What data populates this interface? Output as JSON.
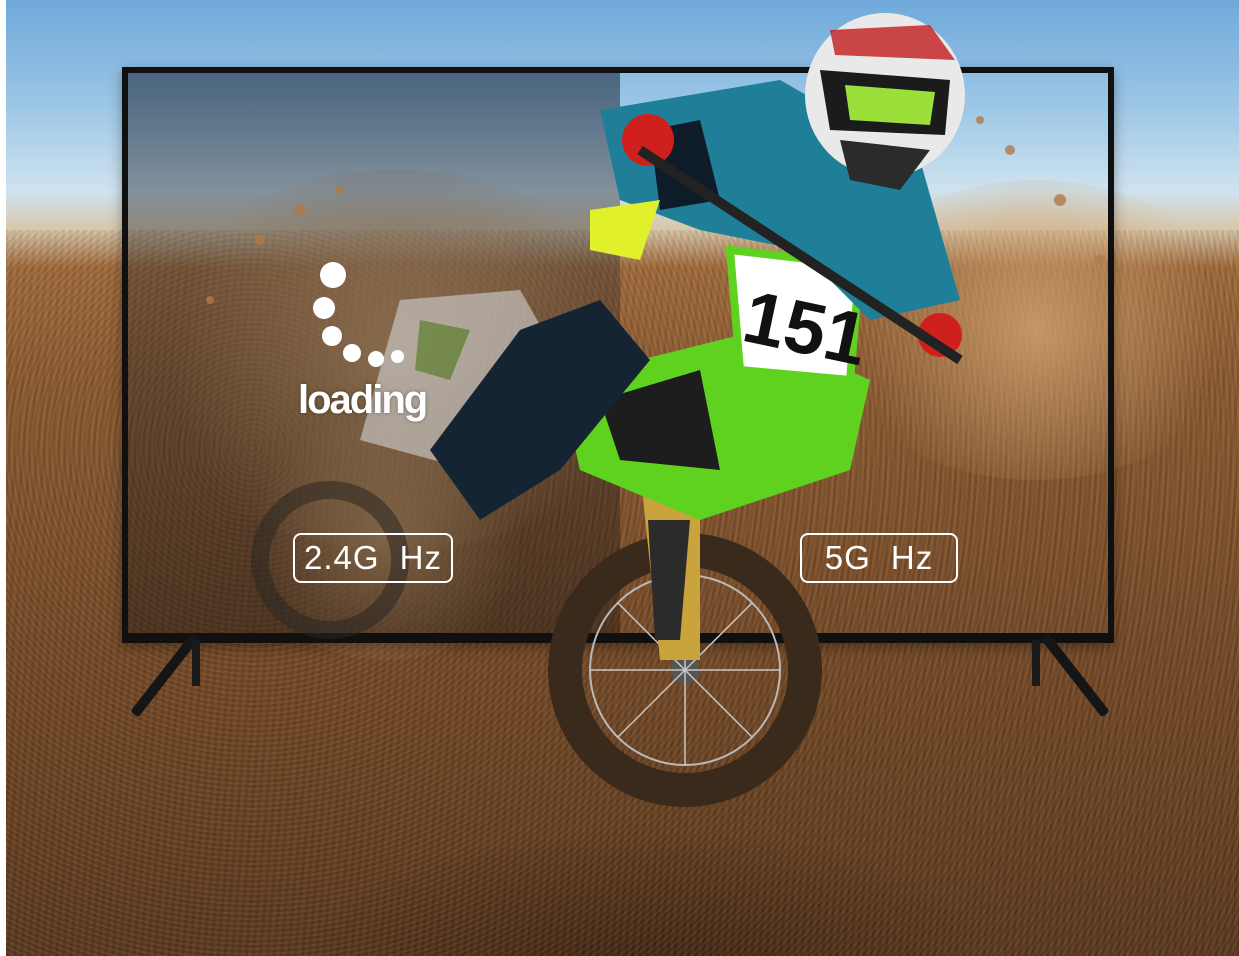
{
  "loading": {
    "text": "loading"
  },
  "bands": [
    {
      "label": "2.4G Hz"
    },
    {
      "label": "5G Hz"
    }
  ],
  "bike": {
    "number": "151"
  },
  "colors": {
    "sky": "#9cc6e6",
    "dirt": "#7a4e2b",
    "bike_green": "#5fd11f",
    "tv_frame": "#101010",
    "jersey_teal": "#1f7f99",
    "glove_red": "#d0201e"
  }
}
